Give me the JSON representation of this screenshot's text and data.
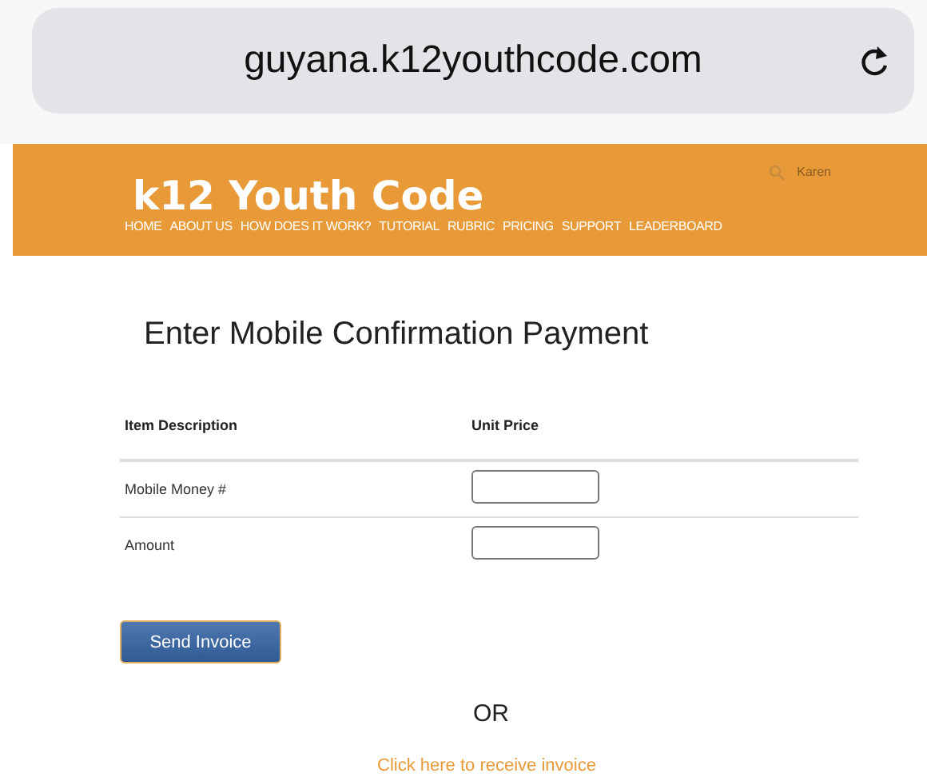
{
  "address_bar": {
    "url": "guyana.k12youthcode.com"
  },
  "header": {
    "logo": "k12 Youth Code",
    "user": "Karen",
    "nav": [
      "HOME",
      "ABOUT US",
      "HOW DOES IT WORK?",
      "TUTORIAL",
      "RUBRIC",
      "PRICING",
      "SUPPORT",
      "LEADERBOARD"
    ]
  },
  "title": "Enter Mobile Confirmation Payment",
  "table": {
    "columns": [
      "Item Description",
      "Unit Price"
    ],
    "rows": [
      {
        "label": "Mobile Money #"
      },
      {
        "label": "Amount"
      }
    ]
  },
  "send_button": "Send Invoice",
  "separator": "OR",
  "receive_link": "Click here to receive invoice"
}
